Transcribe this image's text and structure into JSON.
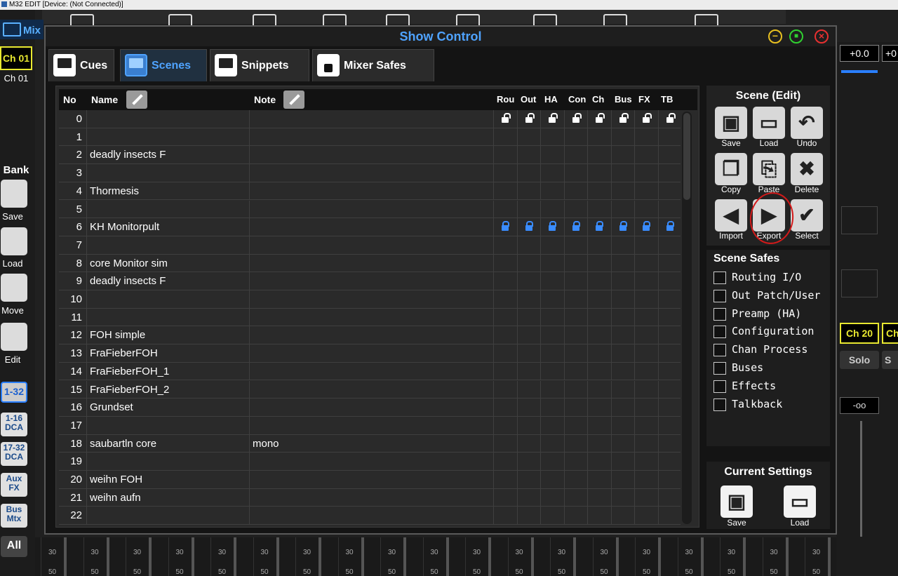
{
  "app_title": "M32 EDIT [Device: (Not Connected)]",
  "mixer": {
    "tab_label": "Mix",
    "left_channel": "Ch 01",
    "left_channel_name": "Ch 01",
    "bank_label": "Bank",
    "left_buttons": [
      {
        "label": "Save",
        "icon": "save-icon"
      },
      {
        "label": "Load",
        "icon": "folder-icon"
      },
      {
        "label": "Move",
        "icon": "swap-icon"
      },
      {
        "label": "Edit",
        "icon": "check-icon"
      }
    ],
    "layers": [
      {
        "label": "1-32",
        "active": true
      },
      {
        "label": "1-16\nDCA",
        "active": false
      },
      {
        "label": "17-32\nDCA",
        "active": false
      },
      {
        "label": "Aux\nFX",
        "active": false
      },
      {
        "label": "Bus\nMtx",
        "active": false
      },
      {
        "label": "All",
        "active": false
      }
    ],
    "right_gain": "+0.0",
    "right_gain_2": "+0",
    "right_channel": "Ch 20",
    "right_channel_2": "Ch",
    "solo": "Solo",
    "solo_2": "S",
    "fader_value": "-oo",
    "scale_marks": [
      "30",
      "50"
    ]
  },
  "dialog": {
    "title": "Show Control",
    "tabs": [
      {
        "label": "Cues",
        "icon": "monitor-icon",
        "active": false
      },
      {
        "label": "Scenes",
        "icon": "monitor-icon",
        "active": true
      },
      {
        "label": "Snippets",
        "icon": "monitor-icon",
        "active": false
      },
      {
        "label": "Mixer Safes",
        "icon": "lock-icon",
        "active": false
      }
    ],
    "table": {
      "headers": {
        "no": "No",
        "name": "Name",
        "note": "Note",
        "safes": [
          "Rou",
          "Out",
          "HA",
          "Con",
          "Ch",
          "Bus",
          "FX",
          "TB"
        ]
      },
      "rows": [
        {
          "no": "0",
          "name": "",
          "note": "",
          "locks": "open"
        },
        {
          "no": "1",
          "name": "",
          "note": "",
          "locks": ""
        },
        {
          "no": "2",
          "name": "deadly insects F",
          "note": "",
          "locks": ""
        },
        {
          "no": "3",
          "name": "",
          "note": "",
          "locks": ""
        },
        {
          "no": "4",
          "name": "Thormesis",
          "note": "",
          "locks": ""
        },
        {
          "no": "5",
          "name": "",
          "note": "",
          "locks": ""
        },
        {
          "no": "6",
          "name": "KH Monitorpult",
          "note": "",
          "locks": "closed"
        },
        {
          "no": "7",
          "name": "",
          "note": "",
          "locks": ""
        },
        {
          "no": "8",
          "name": "core Monitor sim",
          "note": "",
          "locks": ""
        },
        {
          "no": "9",
          "name": "deadly insects F",
          "note": "",
          "locks": ""
        },
        {
          "no": "10",
          "name": "",
          "note": "",
          "locks": ""
        },
        {
          "no": "11",
          "name": "",
          "note": "",
          "locks": ""
        },
        {
          "no": "12",
          "name": "FOH simple",
          "note": "",
          "locks": ""
        },
        {
          "no": "13",
          "name": "FraFieberFOH",
          "note": "",
          "locks": ""
        },
        {
          "no": "14",
          "name": "FraFieberFOH_1",
          "note": "",
          "locks": ""
        },
        {
          "no": "15",
          "name": "FraFieberFOH_2",
          "note": "",
          "locks": ""
        },
        {
          "no": "16",
          "name": "Grundset",
          "note": "",
          "locks": ""
        },
        {
          "no": "17",
          "name": "",
          "note": "",
          "locks": ""
        },
        {
          "no": "18",
          "name": "saubartln core",
          "note": "mono",
          "locks": ""
        },
        {
          "no": "19",
          "name": "",
          "note": "",
          "locks": ""
        },
        {
          "no": "20",
          "name": "weihn FOH",
          "note": "",
          "locks": ""
        },
        {
          "no": "21",
          "name": "weihn aufn",
          "note": "",
          "locks": ""
        },
        {
          "no": "22",
          "name": "",
          "note": "",
          "locks": ""
        }
      ]
    },
    "scene_edit": {
      "title": "Scene (Edit)",
      "buttons": [
        {
          "label": "Save",
          "icon": "save-icon",
          "glyph": "▣"
        },
        {
          "label": "Load",
          "icon": "folder-icon",
          "glyph": "▭"
        },
        {
          "label": "Undo",
          "icon": "undo-icon",
          "glyph": "↶"
        },
        {
          "label": "Copy",
          "icon": "copy-icon",
          "glyph": "❐"
        },
        {
          "label": "Paste",
          "icon": "paste-icon",
          "glyph": "⎘"
        },
        {
          "label": "Delete",
          "icon": "delete-icon",
          "glyph": "✖"
        },
        {
          "label": "Import",
          "icon": "import-icon",
          "glyph": "◀"
        },
        {
          "label": "Export",
          "icon": "export-icon",
          "glyph": "▶"
        },
        {
          "label": "Select",
          "icon": "check-icon",
          "glyph": "✔"
        }
      ]
    },
    "scene_safes": {
      "title": "Scene Safes",
      "items": [
        "Routing I/O",
        "Out Patch/User",
        "Preamp (HA)",
        "Configuration",
        "Chan Process",
        "Buses",
        "Effects",
        "Talkback"
      ]
    },
    "current_settings": {
      "title": "Current Settings",
      "save": "Save",
      "load": "Load"
    }
  },
  "colors": {
    "accent": "#4fa3ff",
    "lock_closed": "#3a8cff",
    "channel_label": "#e8e830",
    "annotation_circle": "#d41a1a"
  }
}
